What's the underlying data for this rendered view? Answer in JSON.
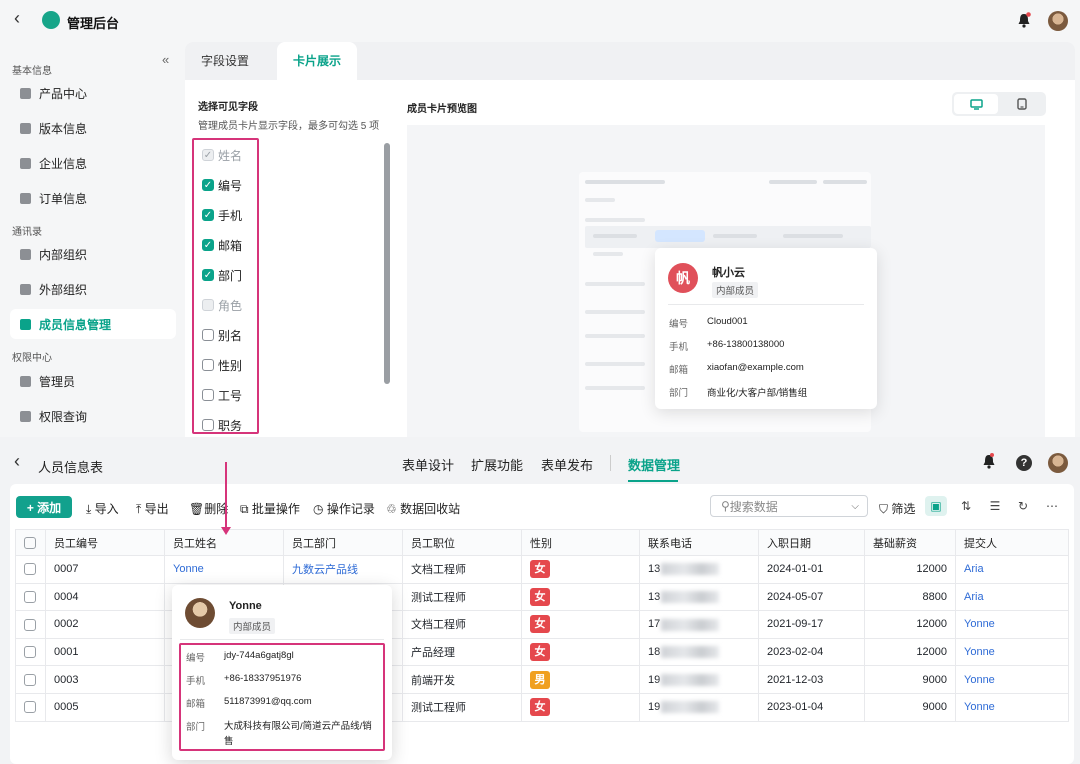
{
  "colors": {
    "accent": "#0aa38a",
    "highlight": "#d6347a",
    "female": "#e5484d",
    "male": "#f0a020",
    "link": "#2e6bd6"
  },
  "top": {
    "title": "管理后台",
    "sidebar": {
      "groups": [
        "基本信息",
        "通讯录",
        "权限中心"
      ],
      "items": [
        {
          "label": "产品中心",
          "icon": "grid-icon"
        },
        {
          "label": "版本信息",
          "icon": "layers-icon"
        },
        {
          "label": "企业信息",
          "icon": "building-icon"
        },
        {
          "label": "订单信息",
          "icon": "order-icon"
        },
        {
          "label": "内部组织",
          "icon": "org-icon"
        },
        {
          "label": "外部组织",
          "icon": "external-org-icon"
        },
        {
          "label": "成员信息管理",
          "icon": "member-icon",
          "active": true
        },
        {
          "label": "管理员",
          "icon": "admin-icon"
        },
        {
          "label": "权限查询",
          "icon": "permission-icon"
        }
      ]
    },
    "tabs": [
      "字段设置",
      "卡片展示"
    ],
    "active_tab": "卡片展示",
    "field_section": {
      "title": "选择可见字段",
      "subtitle": "管理成员卡片显示字段，最多可勾选 5 项"
    },
    "fields": [
      {
        "label": "姓名",
        "state": "checked-disabled"
      },
      {
        "label": "编号",
        "state": "checked"
      },
      {
        "label": "手机",
        "state": "checked"
      },
      {
        "label": "邮箱",
        "state": "checked"
      },
      {
        "label": "部门",
        "state": "checked"
      },
      {
        "label": "角色",
        "state": "disabled"
      },
      {
        "label": "别名",
        "state": "unchecked"
      },
      {
        "label": "性别",
        "state": "unchecked"
      },
      {
        "label": "工号",
        "state": "unchecked"
      },
      {
        "label": "职务",
        "state": "unchecked"
      }
    ],
    "preview_title": "成员卡片预览图",
    "view_toggle": {
      "desktop_icon": "monitor-icon",
      "mobile_icon": "tablet-icon",
      "selected": "desktop"
    },
    "preview_card": {
      "avatar_char": "帆",
      "name": "帆小云",
      "tag": "内部成员",
      "rows": [
        {
          "label": "编号",
          "value": "Cloud001"
        },
        {
          "label": "手机",
          "value": "+86-13800138000"
        },
        {
          "label": "邮箱",
          "value": "xiaofan@example.com"
        },
        {
          "label": "部门",
          "value": "商业化/大客户部/销售组"
        }
      ]
    }
  },
  "bottom": {
    "title": "人员信息表",
    "tabs": [
      "表单设计",
      "扩展功能",
      "表单发布",
      "数据管理"
    ],
    "active_tab": "数据管理",
    "toolbar": {
      "add": "+ 添加",
      "import": "导入",
      "export": "导出",
      "delete": "删除",
      "batch": "批量操作",
      "log": "操作记录",
      "recycle": "数据回收站",
      "search_placeholder": "搜索数据",
      "filter": "筛选"
    },
    "columns": [
      "员工编号",
      "员工姓名",
      "员工部门",
      "员工职位",
      "性别",
      "联系电话",
      "入职日期",
      "基础薪资",
      "提交人"
    ],
    "rows": [
      {
        "id": "0007",
        "name": "Yonne",
        "dept": "九数云产品线",
        "position": "文档工程师",
        "gender": "女",
        "phone_prefix": "13",
        "date": "2024-01-01",
        "salary": "12000",
        "submitter": "Aria"
      },
      {
        "id": "0004",
        "name": "",
        "dept": "",
        "position": "测试工程师",
        "gender": "女",
        "phone_prefix": "13",
        "date": "2024-05-07",
        "salary": "8800",
        "submitter": "Aria"
      },
      {
        "id": "0002",
        "name": "",
        "dept": "",
        "position": "文档工程师",
        "gender": "女",
        "phone_prefix": "17",
        "date": "2021-09-17",
        "salary": "12000",
        "submitter": "Yonne"
      },
      {
        "id": "0001",
        "name": "",
        "dept": "",
        "position": "产品经理",
        "gender": "女",
        "phone_prefix": "18",
        "date": "2023-02-04",
        "salary": "12000",
        "submitter": "Yonne"
      },
      {
        "id": "0003",
        "name": "",
        "dept": "",
        "position": "前端开发",
        "gender": "男",
        "phone_prefix": "19",
        "date": "2021-12-03",
        "salary": "9000",
        "submitter": "Yonne"
      },
      {
        "id": "0005",
        "name": "",
        "dept": "",
        "position": "测试工程师",
        "gender": "女",
        "phone_prefix": "19",
        "date": "2023-01-04",
        "salary": "9000",
        "submitter": "Yonne"
      }
    ],
    "popup": {
      "name": "Yonne",
      "tag": "内部成员",
      "rows": [
        {
          "label": "编号",
          "value": "jdy-744a6gatj8gl"
        },
        {
          "label": "手机",
          "value": "+86-18337951976"
        },
        {
          "label": "邮箱",
          "value": "511873991@qq.com"
        },
        {
          "label": "部门",
          "value": "大成科技有限公司/简道云产品线/销售"
        }
      ]
    }
  }
}
